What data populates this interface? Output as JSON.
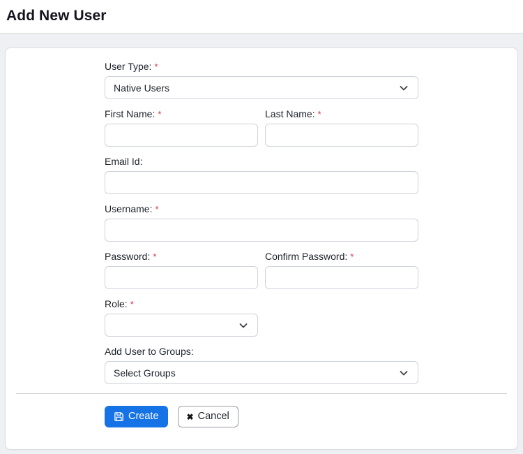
{
  "page_title": "Add New User",
  "required_marker": "*",
  "colors": {
    "primary_button": "#1673e6",
    "required_asterisk": "#dc3545",
    "page_background": "#eef0f3",
    "card_background": "#ffffff",
    "input_border": "#ced3da"
  },
  "form": {
    "fields": {
      "user_type": {
        "label": "User Type:",
        "required": true,
        "type": "select",
        "value": "Native Users"
      },
      "first_name": {
        "label": "First Name:",
        "required": true,
        "type": "text",
        "value": ""
      },
      "last_name": {
        "label": "Last Name:",
        "required": true,
        "type": "text",
        "value": ""
      },
      "email": {
        "label": "Email Id:",
        "required": false,
        "type": "text",
        "value": ""
      },
      "username": {
        "label": "Username:",
        "required": true,
        "type": "text",
        "value": ""
      },
      "password": {
        "label": "Password:",
        "required": true,
        "type": "password",
        "value": ""
      },
      "confirm_password": {
        "label": "Confirm Password:",
        "required": true,
        "type": "password",
        "value": ""
      },
      "role": {
        "label": "Role:",
        "required": true,
        "type": "select",
        "value": ""
      },
      "groups": {
        "label": "Add User to Groups:",
        "required": false,
        "type": "select",
        "value": "Select Groups"
      }
    },
    "buttons": {
      "create": "Create",
      "cancel": "Cancel"
    },
    "icons": {
      "create_icon": "save-icon",
      "cancel_icon": "x-icon",
      "cancel_glyph": "✖",
      "select_icon": "chevron-down-icon"
    }
  }
}
